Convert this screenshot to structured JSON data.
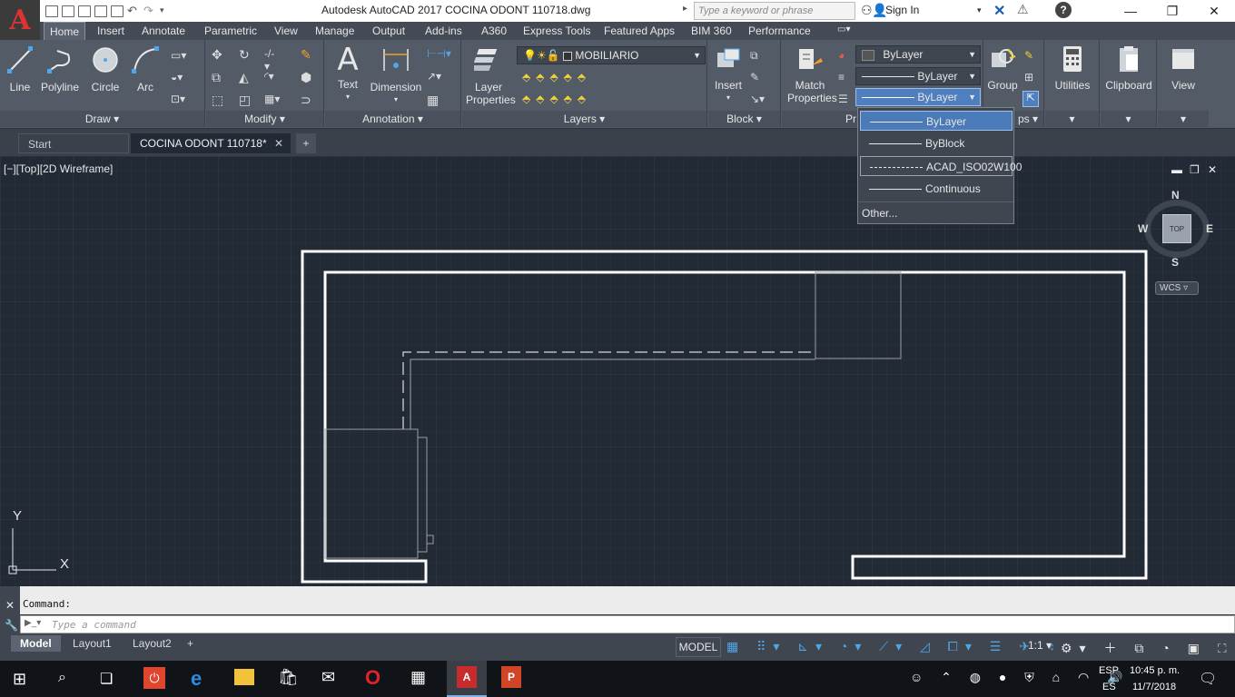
{
  "app": {
    "icon_letter": "A",
    "title": "Autodesk AutoCAD 2017    COCINA ODONT 110718.dwg",
    "search_placeholder": "Type a keyword or phrase",
    "signin": "Sign In"
  },
  "ribbon_tabs": [
    "Home",
    "Insert",
    "Annotate",
    "Parametric",
    "View",
    "Manage",
    "Output",
    "Add-ins",
    "A360",
    "Express Tools",
    "Featured Apps",
    "BIM 360",
    "Performance"
  ],
  "draw": {
    "title": "Draw",
    "line": "Line",
    "polyline": "Polyline",
    "circle": "Circle",
    "arc": "Arc"
  },
  "modify": {
    "title": "Modify"
  },
  "annotation": {
    "title": "Annotation",
    "text": "Text",
    "dimension": "Dimension"
  },
  "layers": {
    "title": "Layers",
    "properties": "Layer\nProperties",
    "current_layer": "MOBILIARIO"
  },
  "block": {
    "title": "Block",
    "insert": "Insert"
  },
  "properties": {
    "title": "Pr",
    "match": "Match\nProperties",
    "color": "ByLayer",
    "linetype": "ByLayer",
    "lineweight": "ByLayer"
  },
  "groups": {
    "title": "ps",
    "group": "Group"
  },
  "utilities": "Utilities",
  "clipboard": "Clipboard",
  "view": "View",
  "linetype_menu": {
    "items": [
      "ByLayer",
      "ByBlock",
      "ACAD_ISO02W100",
      "Continuous"
    ],
    "selected": 0,
    "other": "Other..."
  },
  "doc_tabs": [
    "Start",
    "COCINA ODONT 110718*"
  ],
  "viewport_label": "[−][Top][2D Wireframe]",
  "viewcube": {
    "n": "N",
    "s": "S",
    "e": "E",
    "w": "W",
    "top": "TOP",
    "wcs": "WCS"
  },
  "ucs": {
    "x": "X",
    "y": "Y"
  },
  "command": {
    "history": "Command:",
    "placeholder": "Type a command"
  },
  "layout_tabs": [
    "Model",
    "Layout1",
    "Layout2"
  ],
  "status": {
    "model": "MODEL",
    "scale": "1:1"
  },
  "taskbar": {
    "lang1": "ESP",
    "lang2": "ES",
    "time": "10:45 p. m.",
    "date": "11/7/2018"
  }
}
